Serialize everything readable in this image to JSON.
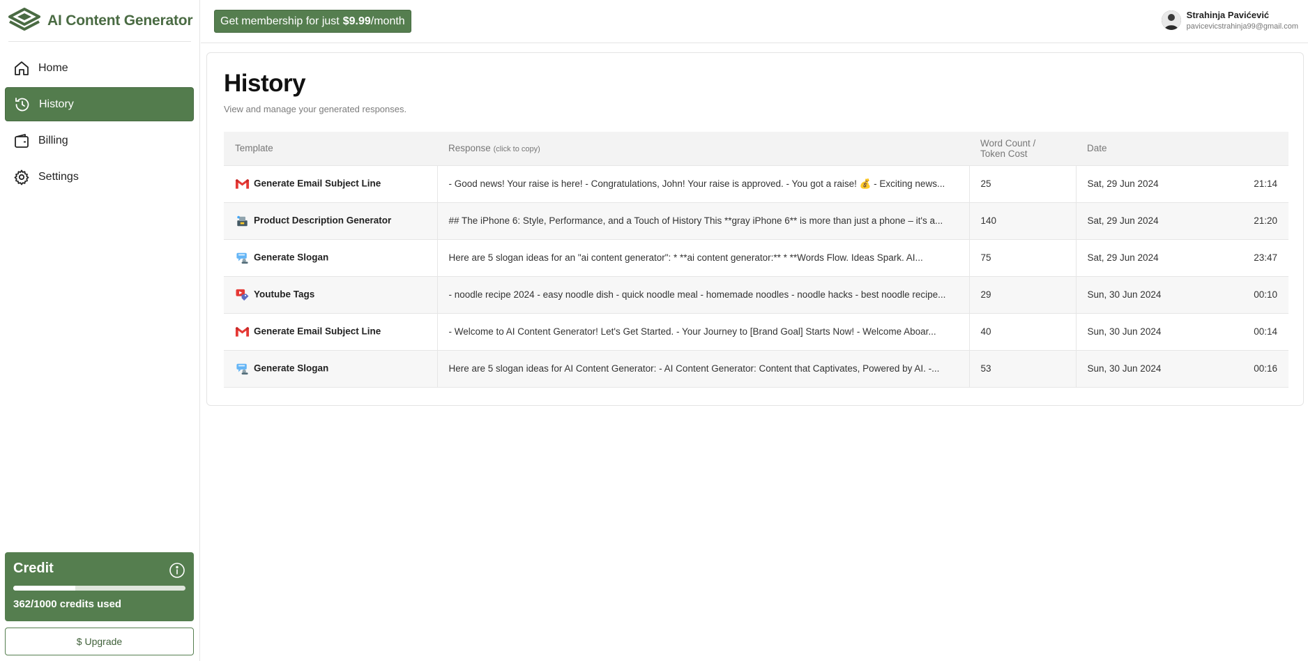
{
  "app": {
    "name": "AI Content Generator"
  },
  "promo": {
    "prefix": "Get membership for just",
    "price": "$9.99",
    "suffix": "/month"
  },
  "user": {
    "name": "Strahinja Pavićević",
    "email": "pavicevicstrahinja99@gmail.com"
  },
  "nav": [
    {
      "label": "Home",
      "icon": "home-icon"
    },
    {
      "label": "History",
      "icon": "history-icon",
      "active": true
    },
    {
      "label": "Billing",
      "icon": "wallet-icon"
    },
    {
      "label": "Settings",
      "icon": "gear-icon"
    }
  ],
  "credit": {
    "title": "Credit",
    "used_label": "362/1000 credits used",
    "used": 362,
    "total": 1000
  },
  "upgrade_label": "$ Upgrade",
  "page": {
    "title": "History",
    "subtitle": "View and manage your generated responses."
  },
  "table": {
    "headers": {
      "template": "Template",
      "response": "Response",
      "response_hint": "(click to copy)",
      "word_count_1": "Word Count /",
      "word_count_2": "Token Cost",
      "date": "Date"
    },
    "rows": [
      {
        "icon": "gmail-icon",
        "template": "Generate Email Subject Line",
        "response": "- Good news! Your raise is here! - Congratulations, John! Your raise is approved. - You got a raise! 💰 - Exciting news...",
        "words": "25",
        "date": "Sat, 29 Jun 2024",
        "time": "21:14"
      },
      {
        "icon": "product-icon",
        "template": "Product Description Generator",
        "response": "## The iPhone 6: Style, Performance, and a Touch of History This **gray iPhone 6** is more than just a phone – it's a...",
        "words": "140",
        "date": "Sat, 29 Jun 2024",
        "time": "21:20"
      },
      {
        "icon": "slogan-icon",
        "template": "Generate Slogan",
        "response": "Here are 5 slogan ideas for an \"ai content generator\": * **ai content generator:** * **Words Flow. Ideas Spark. AI...",
        "words": "75",
        "date": "Sat, 29 Jun 2024",
        "time": "23:47"
      },
      {
        "icon": "youtube-tags-icon",
        "template": "Youtube Tags",
        "response": "- noodle recipe 2024 - easy noodle dish - quick noodle meal - homemade noodles - noodle hacks - best noodle recipe...",
        "words": "29",
        "date": "Sun, 30 Jun 2024",
        "time": "00:10"
      },
      {
        "icon": "gmail-icon",
        "template": "Generate Email Subject Line",
        "response": "- Welcome to AI Content Generator! Let's Get Started. - Your Journey to [Brand Goal] Starts Now! - Welcome Aboar...",
        "words": "40",
        "date": "Sun, 30 Jun 2024",
        "time": "00:14"
      },
      {
        "icon": "slogan-icon",
        "template": "Generate Slogan",
        "response": "Here are 5 slogan ideas for AI Content Generator: - AI Content Generator: Content that Captivates, Powered by AI. -...",
        "words": "53",
        "date": "Sun, 30 Jun 2024",
        "time": "00:16"
      }
    ]
  },
  "colors": {
    "brand": "#557e4f",
    "brand_dark": "#476b42",
    "text": "#1f1f1f",
    "muted": "#7c7c7c"
  }
}
